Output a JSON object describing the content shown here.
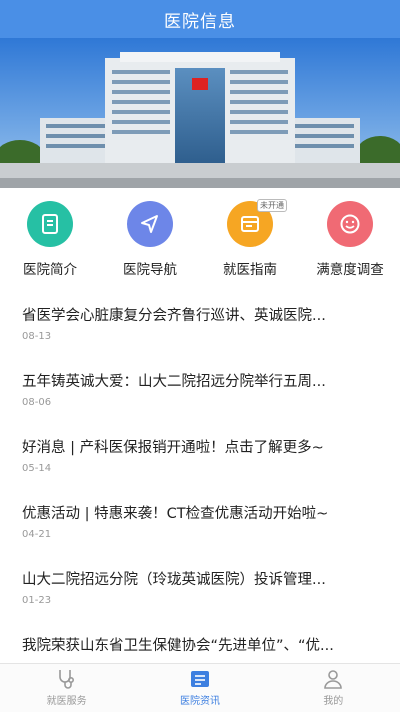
{
  "header": {
    "title": "医院信息"
  },
  "menu": {
    "items": [
      {
        "label": "医院简介",
        "icon": "document-icon",
        "color": "#26c0a4"
      },
      {
        "label": "医院导航",
        "icon": "navigation-arrow-icon",
        "color": "#6d86e8"
      },
      {
        "label": "就医指南",
        "icon": "guide-card-icon",
        "color": "#f6a623",
        "badge": "未开通"
      },
      {
        "label": "满意度调查",
        "icon": "smile-icon",
        "color": "#f06a74"
      }
    ]
  },
  "news": [
    {
      "title": "省医学会心脏康复分会齐鲁行巡讲、英诚医院...",
      "date": "08-13"
    },
    {
      "title": "五年铸英诚大爱：山大二院招远分院举行五周...",
      "date": "08-06"
    },
    {
      "title": "好消息 | 产科医保报销开通啦！点击了解更多~",
      "date": "05-14"
    },
    {
      "title": "优惠活动 | 特惠来袭！CT检查优惠活动开始啦~",
      "date": "04-21"
    },
    {
      "title": "山大二院招远分院（玲珑英诚医院）投诉管理...",
      "date": "01-23"
    },
    {
      "title": "我院荣获山东省卫生保健协会“先进单位”、“优...",
      "date": ""
    }
  ],
  "tabbar": {
    "items": [
      {
        "label": "就医服务",
        "icon": "stethoscope-icon",
        "active": false
      },
      {
        "label": "医院资讯",
        "icon": "news-icon",
        "active": true
      },
      {
        "label": "我的",
        "icon": "person-icon",
        "active": false
      }
    ]
  },
  "colors": {
    "header": "#4a8fe6",
    "active_tab": "#3d7fe0"
  }
}
